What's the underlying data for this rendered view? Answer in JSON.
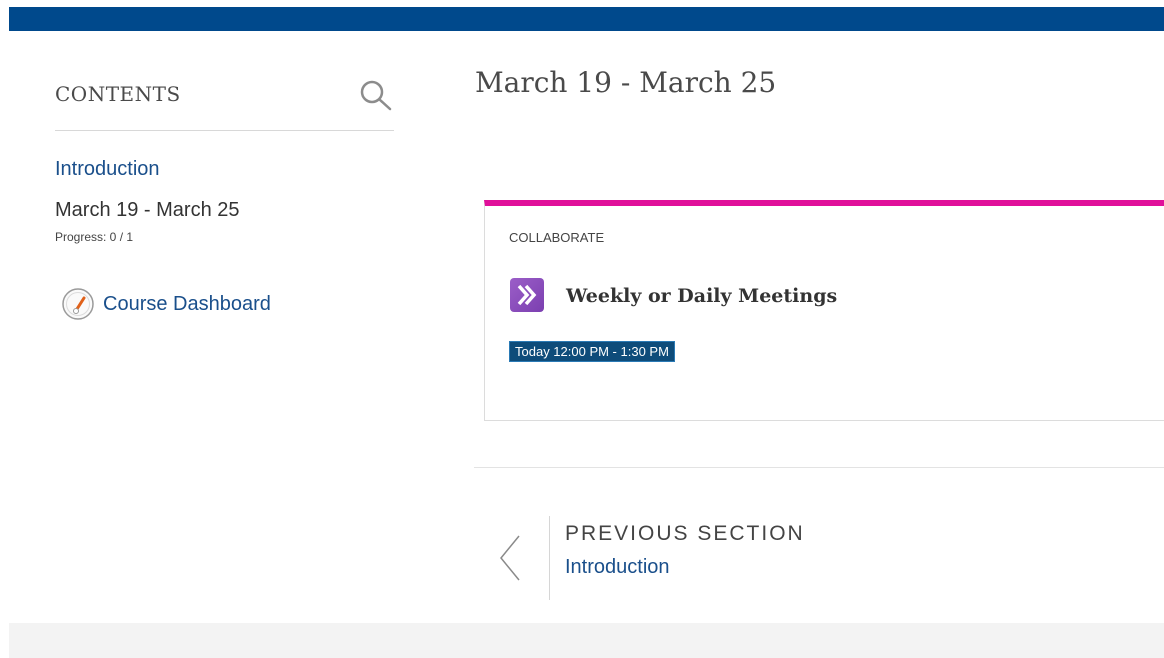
{
  "colors": {
    "topbar": "#00498c",
    "link": "#1a4f8b",
    "card_accent": "#e0109a",
    "badge_bg": "#0e4c7a",
    "collab_icon": "#8a4fc0"
  },
  "sidebar": {
    "heading": "CONTENTS",
    "search_icon": "search-icon",
    "items": [
      {
        "label": "Introduction"
      },
      {
        "label": "March 19 - March 25",
        "progress": "Progress: 0 / 1"
      }
    ],
    "dashboard": {
      "label": "Course Dashboard",
      "icon": "dashboard-gauge-icon"
    }
  },
  "main": {
    "title": "March 19 - March 25",
    "card": {
      "category": "COLLABORATE",
      "icon": "collaborate-icon",
      "title": "Weekly or Daily Meetings",
      "time": "Today 12:00 PM - 1:30 PM"
    },
    "prev_section": {
      "label": "PREVIOUS SECTION",
      "target": "Introduction",
      "icon": "chevron-left-icon"
    }
  }
}
